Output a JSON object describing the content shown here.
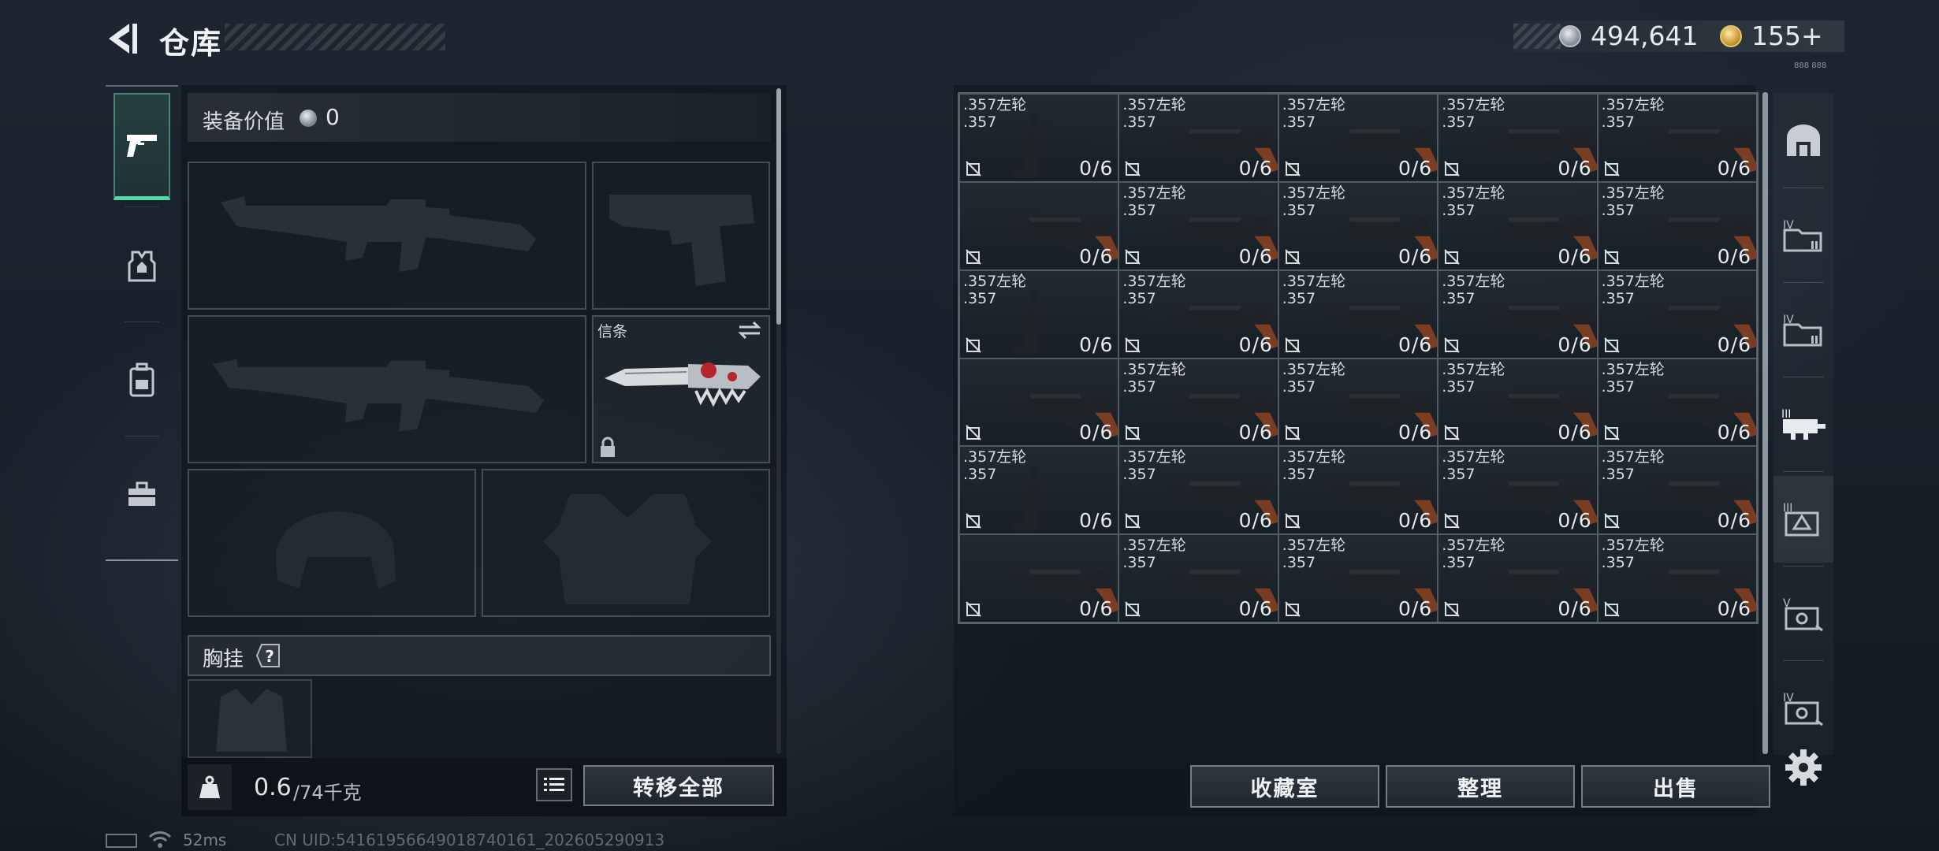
{
  "header": {
    "title": "仓库",
    "silver_amount": "494,641",
    "gold_amount": "155+",
    "small_mark": "888 888"
  },
  "left_tabs": [
    {
      "name": "weapons",
      "icon": "pistol-icon",
      "active": true
    },
    {
      "name": "armor",
      "icon": "vest-icon",
      "active": false
    },
    {
      "name": "backpack",
      "icon": "backpack-icon",
      "active": false
    },
    {
      "name": "toolbox",
      "icon": "toolbox-icon",
      "active": false
    }
  ],
  "loadout": {
    "equip_value_label": "装备价值",
    "equip_value": "0",
    "melee_label": "信条",
    "chest_rig_label": "胸挂",
    "help_symbol": "?",
    "weight_current": "0.6",
    "weight_max": "/74千克",
    "transfer_all_label": "转移全部"
  },
  "storage": {
    "items": [
      {
        "name": ".357左轮",
        "cal": ".357",
        "count": "0/6",
        "tall": true
      },
      {
        "name": ".357左轮",
        "cal": ".357",
        "count": "0/6",
        "tall": false
      },
      {
        "name": ".357左轮",
        "cal": ".357",
        "count": "0/6",
        "tall": false
      },
      {
        "name": ".357左轮",
        "cal": ".357",
        "count": "0/6",
        "tall": false
      },
      {
        "name": ".357左轮",
        "cal": ".357",
        "count": "0/6",
        "tall": false
      },
      {
        "name": "",
        "cal": "",
        "count": "0/6",
        "tall": false
      },
      {
        "name": ".357左轮",
        "cal": ".357",
        "count": "0/6",
        "tall": false
      },
      {
        "name": ".357左轮",
        "cal": ".357",
        "count": "0/6",
        "tall": false
      },
      {
        "name": ".357左轮",
        "cal": ".357",
        "count": "0/6",
        "tall": false
      },
      {
        "name": ".357左轮",
        "cal": ".357",
        "count": "0/6",
        "tall": false
      },
      {
        "name": ".357左轮",
        "cal": ".357",
        "count": "0/6",
        "tall": true
      },
      {
        "name": ".357左轮",
        "cal": ".357",
        "count": "0/6",
        "tall": false
      },
      {
        "name": ".357左轮",
        "cal": ".357",
        "count": "0/6",
        "tall": false
      },
      {
        "name": ".357左轮",
        "cal": ".357",
        "count": "0/6",
        "tall": false
      },
      {
        "name": ".357左轮",
        "cal": ".357",
        "count": "0/6",
        "tall": false
      },
      {
        "name": "",
        "cal": "",
        "count": "0/6",
        "tall": false
      },
      {
        "name": ".357左轮",
        "cal": ".357",
        "count": "0/6",
        "tall": false
      },
      {
        "name": ".357左轮",
        "cal": ".357",
        "count": "0/6",
        "tall": false
      },
      {
        "name": ".357左轮",
        "cal": ".357",
        "count": "0/6",
        "tall": false
      },
      {
        "name": ".357左轮",
        "cal": ".357",
        "count": "0/6",
        "tall": false
      },
      {
        "name": ".357左轮",
        "cal": ".357",
        "count": "0/6",
        "tall": true
      },
      {
        "name": ".357左轮",
        "cal": ".357",
        "count": "0/6",
        "tall": false
      },
      {
        "name": ".357左轮",
        "cal": ".357",
        "count": "0/6",
        "tall": false
      },
      {
        "name": ".357左轮",
        "cal": ".357",
        "count": "0/6",
        "tall": false
      },
      {
        "name": ".357左轮",
        "cal": ".357",
        "count": "0/6",
        "tall": false
      },
      {
        "name": "",
        "cal": "",
        "count": "0/6",
        "tall": false
      },
      {
        "name": ".357左轮",
        "cal": ".357",
        "count": "0/6",
        "tall": false
      },
      {
        "name": ".357左轮",
        "cal": ".357",
        "count": "0/6",
        "tall": false
      },
      {
        "name": ".357左轮",
        "cal": ".357",
        "count": "0/6",
        "tall": false
      },
      {
        "name": ".357左轮",
        "cal": ".357",
        "count": "0/6",
        "tall": false
      }
    ],
    "collection_label": "收藏室",
    "organize_label": "整理",
    "sell_label": "出售"
  },
  "right_tabs": [
    {
      "name": "storage-room",
      "icon": "safe-room-icon"
    },
    {
      "name": "storage-iv-1",
      "icon": "folder-iv-icon"
    },
    {
      "name": "storage-iv-2",
      "icon": "folder-iv-icon"
    },
    {
      "name": "storage-iii-gun",
      "icon": "gun-rack-icon"
    },
    {
      "name": "storage-iii-tri",
      "icon": "crate-iii-icon"
    },
    {
      "name": "storage-v",
      "icon": "crate-v-icon"
    },
    {
      "name": "storage-iv-3",
      "icon": "crate-iv-icon"
    },
    {
      "name": "settings",
      "icon": "gear-icon"
    }
  ],
  "footer": {
    "ping": "52ms",
    "uid": "CN UID:5416195664901874016​1_202605290913"
  },
  "colors": {
    "accent_green": "#58d6a0",
    "panel_border": "#96a0a8",
    "text_main": "#e4e7ea"
  }
}
